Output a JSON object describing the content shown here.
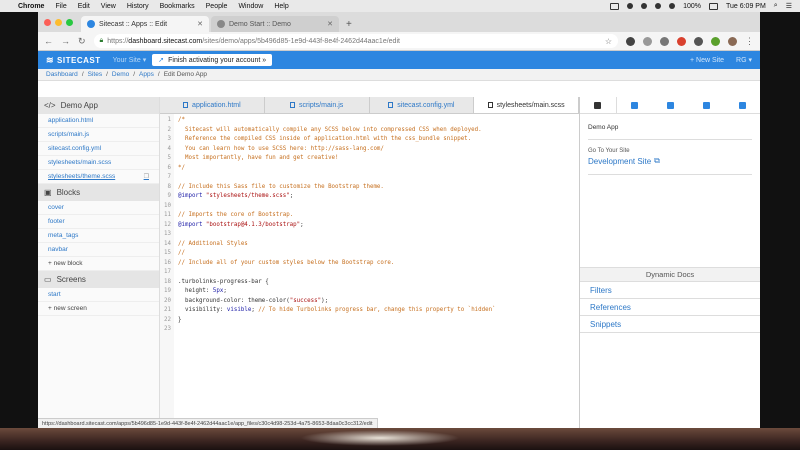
{
  "menubar": {
    "app_name": "Chrome",
    "menus": [
      "File",
      "Edit",
      "View",
      "History",
      "Bookmarks",
      "People",
      "Window",
      "Help"
    ],
    "battery": "100%",
    "clock": "Tue 6:09 PM"
  },
  "browser": {
    "tabs": [
      {
        "title": "Sitecast :: Apps :: Edit"
      },
      {
        "title": "Demo Start :: Demo"
      }
    ],
    "new_tab_label": "+",
    "url": {
      "scheme": "https://",
      "host": "dashboard.sitecast.com",
      "path": "/sites/demo/apps/5b496d85-1e9d-443f-8e4f-2462d44aac1e/edit"
    },
    "status_url": "https://dashboard.sitecast.com/apps/5b496d85-1e9d-443f-8e4f-2462d44aac1e/app_files/c30c4d98-253d-4a75-8653-8daa0c3cc312/edit"
  },
  "appnav": {
    "brand": "SITECAST",
    "site_selector": "Your Site",
    "callout": "Finish activating your account »",
    "new_site": "+ New Site",
    "user": "RG"
  },
  "breadcrumb": [
    "Dashboard",
    "Sites",
    "Demo",
    "Apps",
    "Edit Demo App"
  ],
  "sidebar": {
    "app_title": "Demo App",
    "files": [
      "application.html",
      "scripts/main.js",
      "sitecast.config.yml",
      "stylesheets/main.scss",
      "stylesheets/theme.scss"
    ],
    "blocks_title": "Blocks",
    "blocks": [
      "cover",
      "footer",
      "meta_tags",
      "navbar"
    ],
    "new_block": "+ new block",
    "screens_title": "Screens",
    "screens": [
      "start"
    ],
    "new_screen": "+ new screen"
  },
  "editor": {
    "tabs": [
      "application.html",
      "scripts/main.js",
      "sitecast.config.yml",
      "stylesheets/main.scss"
    ],
    "active_tab": 3,
    "lines": [
      [
        {
          "t": "/*",
          "c": "c-comment"
        }
      ],
      [
        {
          "t": "  Sitecast will automatically compile any SCSS below into compressed CSS when deployed.",
          "c": "c-comment"
        }
      ],
      [
        {
          "t": "  Reference the compiled CSS inside of application.html with the css_bundle snippet.",
          "c": "c-comment"
        }
      ],
      [
        {
          "t": "  You can learn how to use SCSS here: http://sass-lang.com/",
          "c": "c-comment"
        }
      ],
      [
        {
          "t": "  Most importantly, have fun and get creative!",
          "c": "c-comment"
        }
      ],
      [
        {
          "t": "*/",
          "c": "c-comment"
        }
      ],
      [
        {
          "t": "",
          "c": "c-plain"
        }
      ],
      [
        {
          "t": "// Include this Sass file to customize the Bootstrap theme.",
          "c": "c-comment"
        }
      ],
      [
        {
          "t": "@import ",
          "c": "c-kw"
        },
        {
          "t": "\"stylesheets/theme.scss\"",
          "c": "c-str"
        },
        {
          "t": ";",
          "c": "c-plain"
        }
      ],
      [
        {
          "t": "",
          "c": "c-plain"
        }
      ],
      [
        {
          "t": "// Imports the core of Bootstrap.",
          "c": "c-comment"
        }
      ],
      [
        {
          "t": "@import ",
          "c": "c-kw"
        },
        {
          "t": "\"bootstrap@4.1.3/bootstrap\"",
          "c": "c-str"
        },
        {
          "t": ";",
          "c": "c-plain"
        }
      ],
      [
        {
          "t": "",
          "c": "c-plain"
        }
      ],
      [
        {
          "t": "// Additional Styles",
          "c": "c-comment"
        }
      ],
      [
        {
          "t": "//",
          "c": "c-comment"
        }
      ],
      [
        {
          "t": "// Include all of your custom styles below the Bootstrap core.",
          "c": "c-comment"
        }
      ],
      [
        {
          "t": "",
          "c": "c-plain"
        }
      ],
      [
        {
          "t": ".turbolinks-progress-bar {",
          "c": "c-plain"
        }
      ],
      [
        {
          "t": "  height: ",
          "c": "c-prop"
        },
        {
          "t": "5px",
          "c": "c-kw"
        },
        {
          "t": ";",
          "c": "c-plain"
        }
      ],
      [
        {
          "t": "  background-color: ",
          "c": "c-prop"
        },
        {
          "t": "theme-color(",
          "c": "c-plain"
        },
        {
          "t": "\"success\"",
          "c": "c-str"
        },
        {
          "t": ");",
          "c": "c-plain"
        }
      ],
      [
        {
          "t": "  visibility: ",
          "c": "c-prop"
        },
        {
          "t": "visible",
          "c": "c-kw"
        },
        {
          "t": "; ",
          "c": "c-plain"
        },
        {
          "t": "// To hide Turbolinks progress bar, change this property to `hidden`",
          "c": "c-comment"
        }
      ],
      [
        {
          "t": "}",
          "c": "c-plain"
        }
      ],
      [
        {
          "t": "",
          "c": "c-plain"
        }
      ]
    ]
  },
  "panel": {
    "app_name": "Demo App",
    "go_to_label": "Go To Your Site",
    "site_link": "Development Site",
    "docs_title": "Dynamic Docs",
    "docs_links": [
      "Filters",
      "References",
      "Snippets"
    ]
  },
  "colors": {
    "brand_blue": "#2d86e0",
    "link_blue": "#2d78c7",
    "comment_orange": "#c66f1e"
  }
}
